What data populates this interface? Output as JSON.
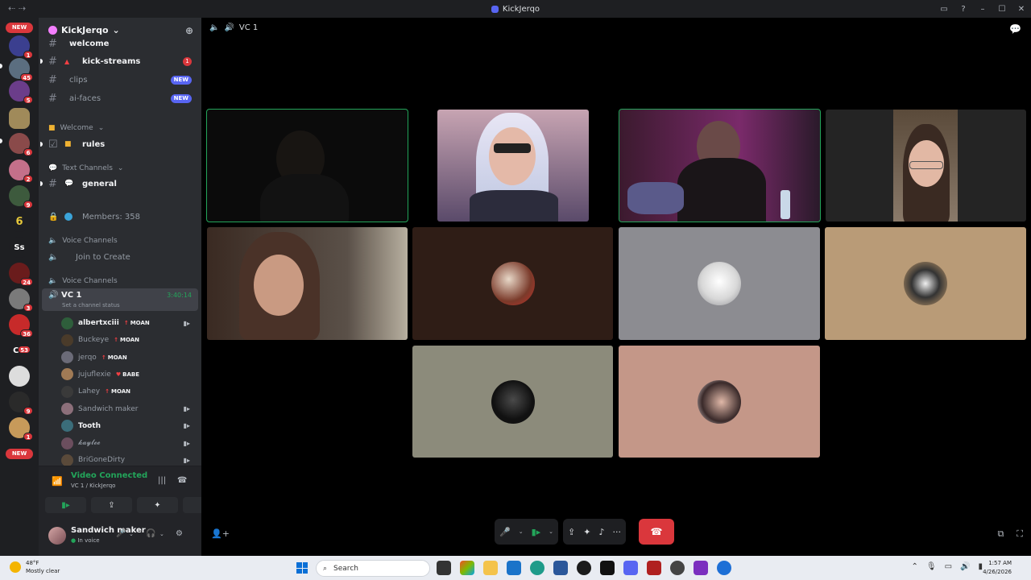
{
  "titlebar": {
    "title": "KickJerqo"
  },
  "server_rail": {
    "new_label": "NEW",
    "badges": [
      "1",
      "45",
      "5",
      "6",
      "2",
      "9",
      "24",
      "3",
      "36",
      "53",
      "9",
      "1"
    ],
    "text_servers": [
      "Ss",
      "CH"
    ]
  },
  "guild": {
    "name": "KickJerqo"
  },
  "channels": {
    "welcome": "welcome",
    "kick_streams": "kick-streams",
    "kick_streams_badge": "1",
    "clips": "clips",
    "clips_badge": "NEW",
    "ai_faces": "ai-faces",
    "ai_faces_badge": "NEW",
    "cat_welcome": "Welcome",
    "rules": "rules",
    "cat_text": "Text Channels",
    "general": "general",
    "members": "Members: 358",
    "cat_voice1": "Voice Channels",
    "join_to_create": "Join to Create",
    "cat_voice2": "Voice Channels",
    "vc1_name": "VC 1",
    "vc1_timer": "3:40:14",
    "vc1_status": "Set a channel status"
  },
  "members": [
    {
      "name": "albertxciii",
      "tag": "MOAN",
      "bold": true,
      "cam": true,
      "color": "#2e5e3b"
    },
    {
      "name": "Buckeye",
      "tag": "MOAN",
      "bold": false,
      "cam": false,
      "color": "#4a3b2a"
    },
    {
      "name": "jerqo",
      "tag": "MOAN",
      "bold": false,
      "cam": false,
      "color": "#6b6b78"
    },
    {
      "name": "jujuflexie",
      "tag": "BABE",
      "bold": false,
      "cam": false,
      "color": "#a07a55"
    },
    {
      "name": "Lahey",
      "tag": "MOAN",
      "bold": false,
      "cam": false,
      "color": "#3a3a3a"
    },
    {
      "name": "Sandwich maker",
      "tag": "",
      "bold": false,
      "cam": true,
      "color": "#8c6f7a"
    },
    {
      "name": "Tooth",
      "tag": "",
      "bold": true,
      "cam": true,
      "color": "#3b6d7a"
    },
    {
      "name": "𝓴𝓪𝔂𝓵𝓮𝓮",
      "tag": "",
      "bold": false,
      "cam": true,
      "color": "#6b4e5e"
    },
    {
      "name": "BriGoneDirty",
      "tag": "",
      "bold": false,
      "cam": true,
      "color": "#5a4a3a"
    }
  ],
  "voice_panel": {
    "title": "Video Connected",
    "subtitle": "VC 1 / KickJerqo"
  },
  "user_panel": {
    "name": "Sandwich maker",
    "status": "In voice"
  },
  "stage": {
    "channel_title": "VC 1"
  },
  "tile_colors": {
    "t5": "#2f1d16",
    "t6": "#8c8c91",
    "t7": "#b99b77",
    "t8": "#8c8b7b",
    "t9": "#c49788"
  },
  "taskbar": {
    "weather_temp": "48°F",
    "weather_desc": "Mostly clear",
    "search_placeholder": "Search",
    "time": "1:57 AM",
    "date": "4/26/2026"
  }
}
